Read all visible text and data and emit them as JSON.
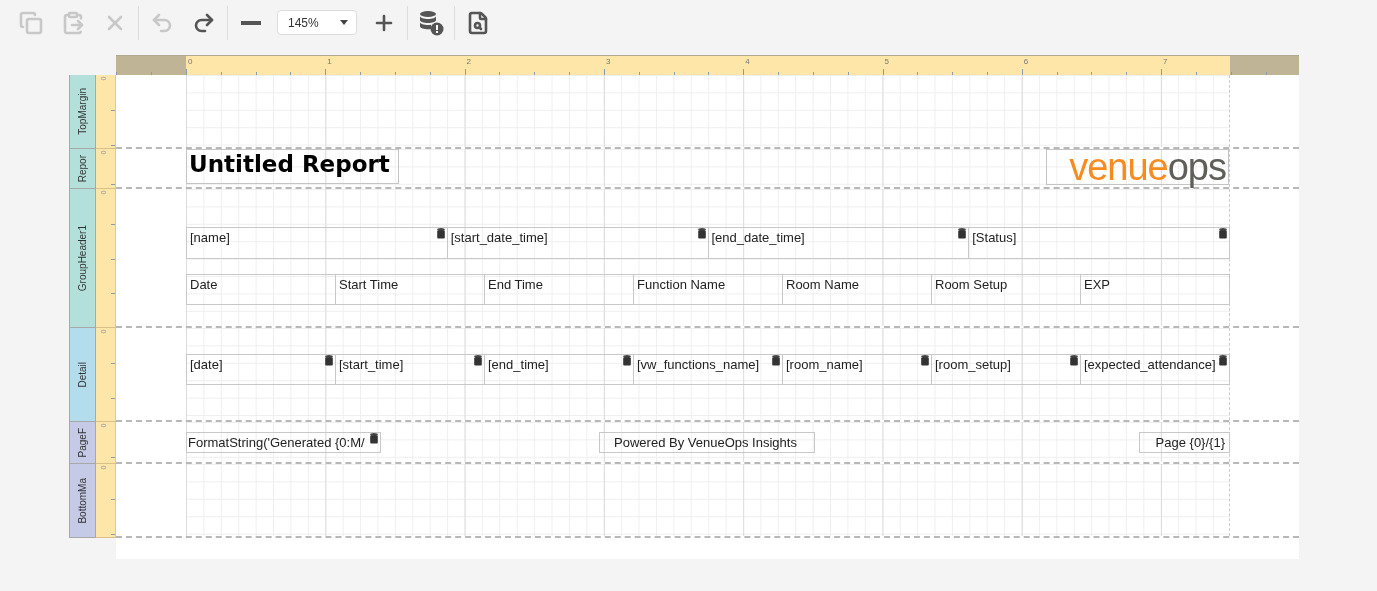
{
  "toolbar": [
    {
      "kind": "copy",
      "disabled": true
    },
    {
      "kind": "paste",
      "disabled": true
    },
    {
      "kind": "delete",
      "disabled": true
    },
    {
      "kind": "separator"
    },
    {
      "kind": "undo",
      "disabled": true
    },
    {
      "kind": "redo",
      "disabled": false
    },
    {
      "kind": "separator"
    },
    {
      "kind": "zoom_out",
      "disabled": false
    },
    {
      "kind": "zoom",
      "value": "145%"
    },
    {
      "kind": "zoom_in",
      "disabled": false
    },
    {
      "kind": "separator"
    },
    {
      "kind": "validate",
      "disabled": false
    },
    {
      "kind": "separator"
    },
    {
      "kind": "preview",
      "disabled": false
    }
  ],
  "ruler": {
    "labels": [
      "0",
      "1",
      "2",
      "3",
      "4",
      "5",
      "6",
      "7"
    ]
  },
  "bands": [
    {
      "kind": "margin",
      "name": "TopMargin",
      "color": "#b3e0da",
      "ruler_label": "0"
    },
    {
      "kind": "report_header",
      "name": "Repor",
      "color": "#b3e0da",
      "ruler_label": "0",
      "title": "Untitled Report",
      "logo": {
        "primary": "venue",
        "secondary": "ops"
      }
    },
    {
      "kind": "group_header",
      "name": "GroupHeader1",
      "color": "#b3e0da",
      "ruler_label": "0",
      "fields": [
        "[name]",
        "[start_date_time]",
        "[end_date_time]",
        "[Status]"
      ],
      "columns": [
        "Date",
        "Start Time",
        "End Time",
        "Function Name",
        "Room Name",
        "Room Setup",
        "EXP"
      ]
    },
    {
      "kind": "detail",
      "name": "Detail",
      "color": "#b3dcec",
      "ruler_label": "0",
      "fields": [
        "[date]",
        "[start_time]",
        "[end_time]",
        "[vw_functions_name]",
        "[room_name]",
        "[room_setup]",
        "[expected_attendance]"
      ]
    },
    {
      "kind": "page_footer",
      "name": "PageF",
      "color": "#c5cbe6",
      "ruler_label": "0",
      "left": "FormatString('Generated {0:M/",
      "center": "Powered By VenueOps Insights",
      "right": "Page {0}/{1}"
    },
    {
      "kind": "margin",
      "name": "BottomMa",
      "color": "#c5cbe6",
      "ruler_label": "0"
    }
  ]
}
